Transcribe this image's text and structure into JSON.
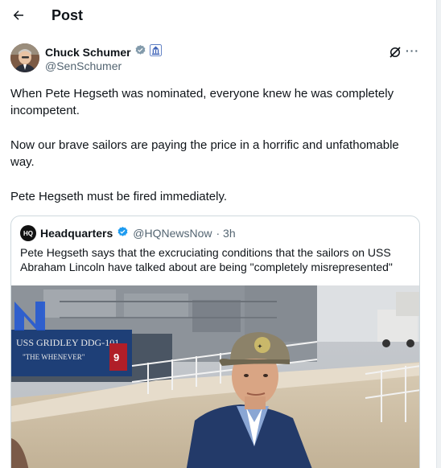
{
  "header": {
    "title": "Post",
    "back_icon": "arrow-left-icon"
  },
  "author": {
    "name": "Chuck Schumer",
    "handle": "@SenSchumer",
    "verified_color": "#829aab",
    "badge_icon": "capitol-building-icon",
    "grok_icon": "grok-icon",
    "more_label": "···"
  },
  "tweet": {
    "para1": "When Pete Hegseth was nominated, everyone knew he was completely incompetent.",
    "para2": "Now our brave sailors are paying the price in a horrific and unfathomable way.",
    "para3": "Pete Hegseth must be fired immediately."
  },
  "quote": {
    "logo_text": "HQ",
    "name": "Headquarters",
    "handle": "@HQNewsNow",
    "time": "· 3h",
    "verified_color": "#1d9bf0",
    "text": "Pete Hegseth says that the excruciating conditions that the sailors on USS Abraham Lincoln have talked about are being \"completely misrepresented\"",
    "media": {
      "ship_sign_line1": "USS GRIDLEY DDG-101",
      "ship_sign_line2": "\"THE WHENEVER\"",
      "hull_number": "9"
    }
  }
}
